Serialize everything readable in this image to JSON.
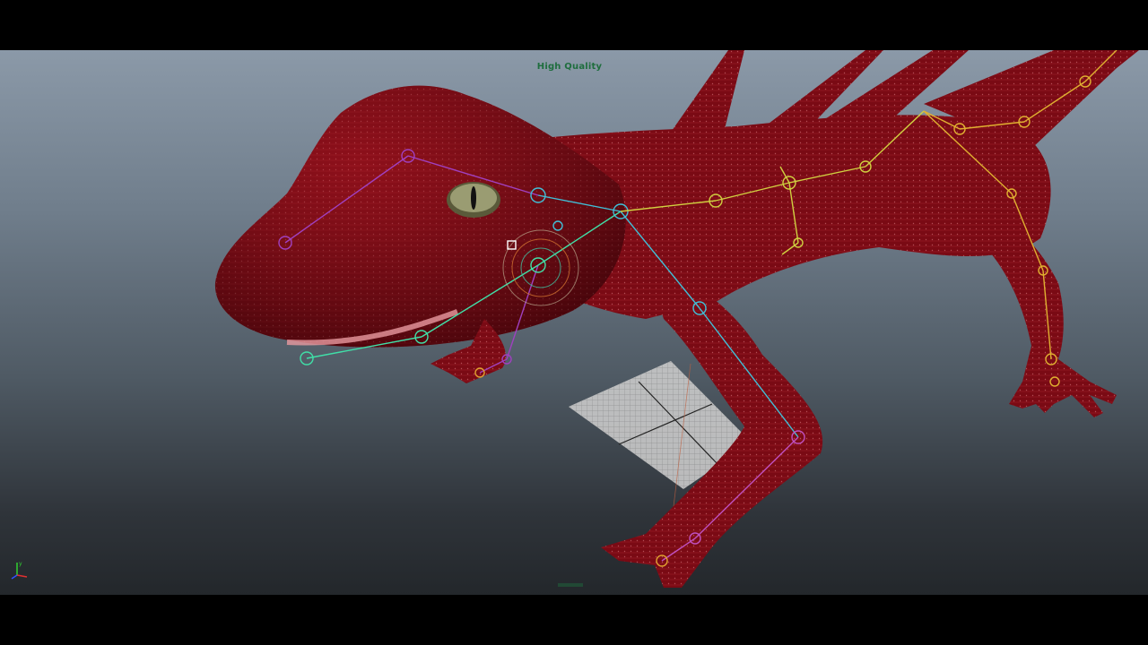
{
  "viewport": {
    "hud_label": "High Quality",
    "background_colors": [
      "#8b99a8",
      "#23272b"
    ]
  },
  "scene": {
    "model": "red-lizard-mesh",
    "model_color": "#7d0a14",
    "skeleton_colors": {
      "head": "#a040c0",
      "jaw": "#40e0a0",
      "neck": "#40c0d8",
      "spine": "#d0d040",
      "back_leg": "#e0b030",
      "front_leg": "#c050c0"
    },
    "icons": [
      "move-manipulator-icon",
      "ground-grid-icon",
      "axis-gizmo-icon"
    ]
  },
  "axis_gizmo": {
    "y_label": "y",
    "colors": {
      "x": "#e03030",
      "y": "#30d030",
      "z": "#3050ff"
    }
  }
}
